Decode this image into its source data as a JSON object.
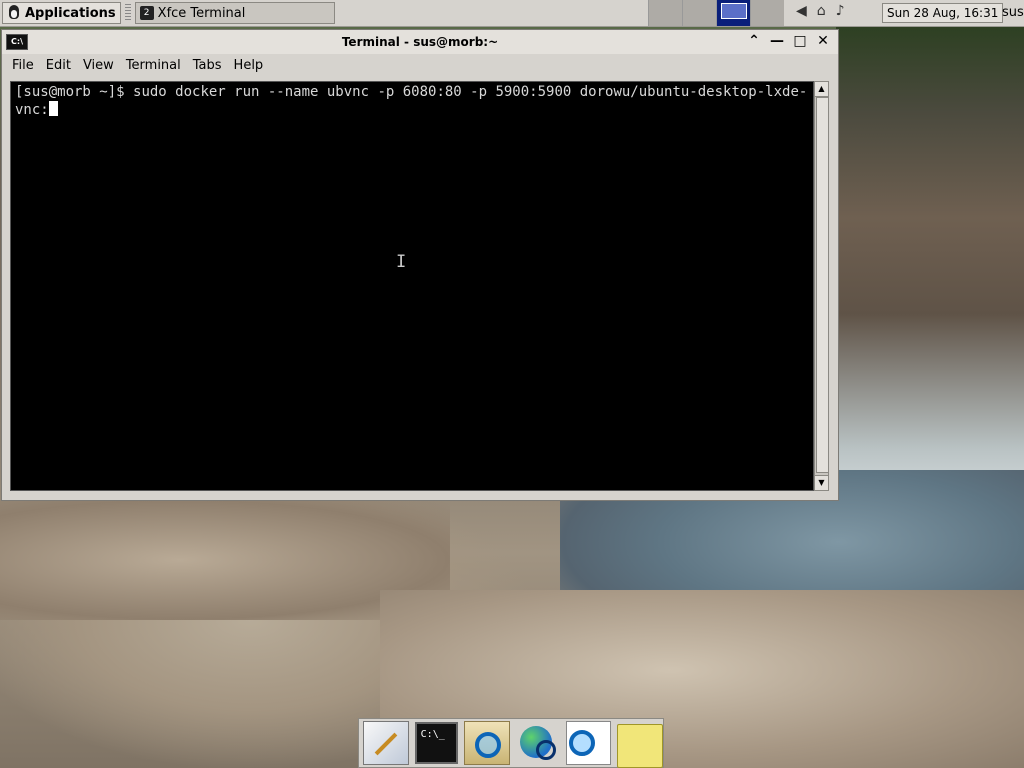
{
  "panel": {
    "apps_label": "Applications",
    "task_label": "Xfce Terminal",
    "task_badge": "2",
    "clock": "Sun 28 Aug, 16:31",
    "user": "sus"
  },
  "window": {
    "title": "Terminal - sus@morb:~",
    "icon_text": "C:\\",
    "menu": [
      "File",
      "Edit",
      "View",
      "Terminal",
      "Tabs",
      "Help"
    ]
  },
  "terminal": {
    "prompt": "[sus@morb ~]$ ",
    "command": "sudo docker run --name ubvnc -p 6080:80 -p 5900:5900 dorowu/ubuntu-desktop-lxde-vnc:"
  },
  "dock": {
    "term_text": "C:\\_"
  }
}
